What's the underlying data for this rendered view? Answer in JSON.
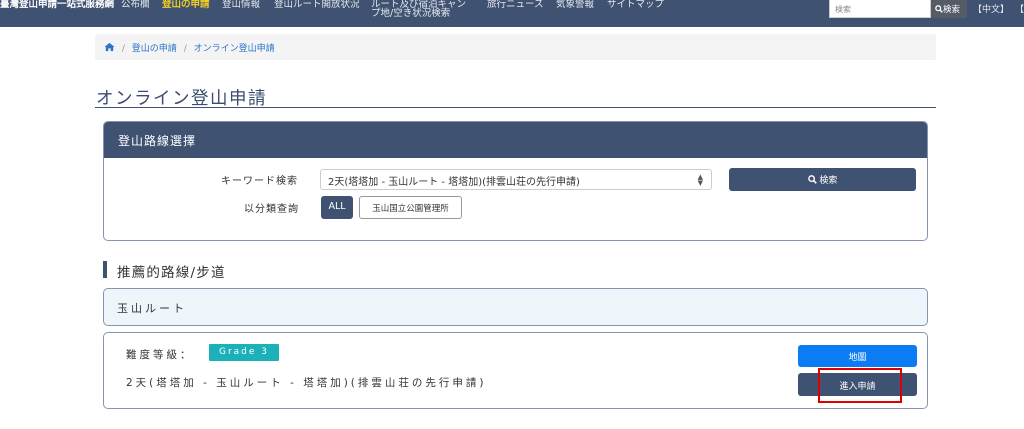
{
  "nav": {
    "brand": "臺灣登山申請一站式服務網",
    "items": [
      {
        "label": "公布欄",
        "active": false
      },
      {
        "label": "登山の申請",
        "active": true
      },
      {
        "label": "登山情報",
        "active": false
      },
      {
        "label": "登山ルート開放状況",
        "active": false
      },
      {
        "label_line1": "ルート及び宿泊キャン",
        "label_line2": "プ地/空き状況検索",
        "active": false
      },
      {
        "label": "旅行ニュース",
        "active": false
      },
      {
        "label": "気象警報",
        "active": false
      },
      {
        "label": "サイトマップ",
        "active": false
      }
    ],
    "search_placeholder": "検索",
    "search_button": "検索",
    "lang_current": "【中文】",
    "lang_next": "【"
  },
  "breadcrumb": {
    "items": [
      "登山の申請",
      "オンライン登山申請"
    ]
  },
  "page_title": "オンライン登山申請",
  "route_selection": {
    "header": "登山路線選擇",
    "keyword_label": "キーワード検索",
    "selected_route": "2天(塔塔加 - 玉山ルート - 塔塔加)(排雲山荘の先行申請)",
    "search_button": "検索",
    "category_label": "以分類查詢",
    "categories": [
      "ALL",
      "玉山国立公園管理所"
    ]
  },
  "recommended": {
    "section_title": "推薦的路線/步道",
    "group_title": "玉山ルート",
    "route": {
      "difficulty_label": "難度等級：",
      "grade": "Grade 3",
      "name": "2天(塔塔加 - 玉山ルート - 塔塔加)(排雲山荘の先行申請)",
      "map_button": "地圖",
      "apply_button": "進入申請"
    }
  },
  "colors": {
    "nav_bg": "#3f5272",
    "nav_active": "#f2d024",
    "primary": "#3f5272",
    "map_button": "#0b7cf3",
    "grade_badge": "#1cb0b9",
    "highlight": "#e00000"
  }
}
